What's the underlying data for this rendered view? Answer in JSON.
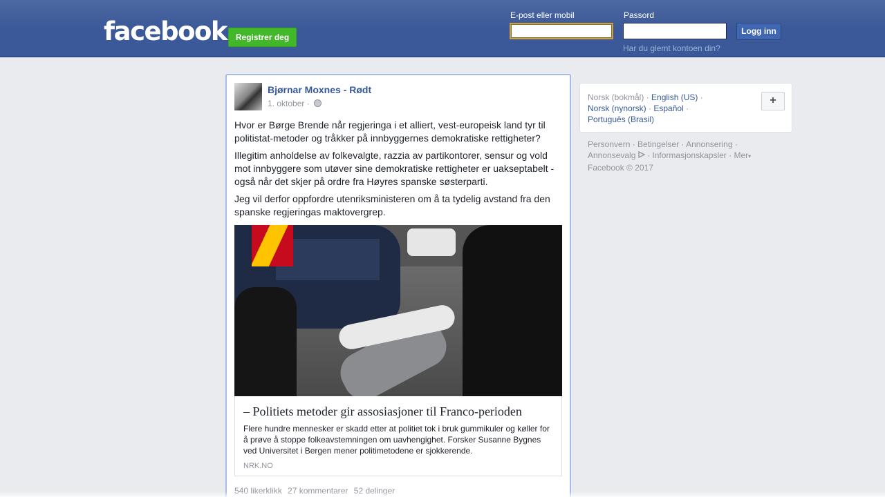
{
  "header": {
    "logo": "facebook",
    "register_label": "Registrer deg",
    "email_label": "E-post eller mobil",
    "email_value": "",
    "password_label": "Passord",
    "password_value": "",
    "login_label": "Logg inn",
    "forgot_label": "Har du glemt kontoen din?"
  },
  "post": {
    "author": "Bjørnar Moxnes - Rødt",
    "date": "1. oktober ·",
    "paragraphs": [
      "Hvor er Børge Brende når regjeringa i et alliert, vest-europeisk land tyr til politistat-metoder og tråkker på innbyggernes demokratiske rettigheter?",
      "Illegitim anholdelse av folkevalgte, razzia av partikontorer, sensur og vold mot innbyggere som utøver sine demokratiske rettigheter er uakseptabelt - også når det skjer på ordre fra Høyres spanske søsterparti.",
      "Jeg vil derfor oppfordre utenriksministeren om å ta tydelig avstand fra den spanske regjeringas maktovergrep."
    ],
    "link": {
      "title": "– Politiets metoder gir assosiasjoner til Franco-perioden",
      "description": "Flere hundre mennesker er skadd etter at politiet tok i bruk gummikuler og køller for å prøve å stoppe folkeavstemningen om uavhengighet. Forsker Susanne Bygnes ved Universitet i Bergen mener politimetodene er sjokkerende.",
      "source": "NRK.NO"
    },
    "stats": {
      "likes": "540 likerklikk",
      "comments": "27 kommentarer",
      "shares": "52 delinger"
    }
  },
  "sidebar": {
    "languages": {
      "current": "Norsk (bokmål)",
      "links": [
        "English (US)",
        "Norsk (nynorsk)",
        "Español",
        "Português (Brasil)"
      ]
    },
    "plus_label": "+",
    "footer": {
      "links": [
        "Personvern",
        "Betingelser",
        "Annonsering",
        "Annonsevalg",
        "Informasjonskapsler",
        "Mer"
      ],
      "copyright": "Facebook © 2017"
    }
  },
  "colors": {
    "header_bg": "#3b5998",
    "link": "#365899",
    "register_green": "#42b72a"
  }
}
